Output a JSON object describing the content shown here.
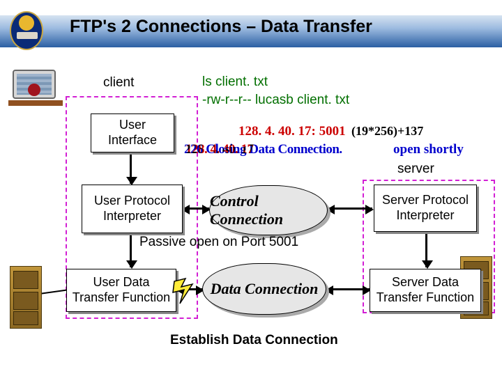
{
  "title": "FTP's 2 Connections – Data Transfer",
  "labels": {
    "client": "client",
    "server": "server",
    "user_interface": "User Interface",
    "user_pi": "User Protocol Interpreter",
    "user_dtf": "User Data Transfer Function",
    "server_pi": "Server Protocol Interpreter",
    "server_dtf": "Server Data Transfer Function",
    "control_conn": "Control Connection",
    "data_conn": "Data Connection",
    "passive_open": "Passive open on Port 5001",
    "establish": "Establish Data Connection"
  },
  "terminal": {
    "line1": "ls client. txt",
    "line2": "-rw-r--r-- lucasb client. txt"
  },
  "messages": {
    "ip_port": "128. 4. 40. 17: 5001",
    "calc": "(19*256)+137",
    "overlay1": "226 Closing Data Connection.",
    "overlay2": "128. 4. 40. 17",
    "overlay_tail": "open shortly"
  },
  "icons": {
    "workstation": "workstation-icon",
    "cabinet": "file-cabinet-icon",
    "bolt": "lightning-connection-icon",
    "logo": "university-crest-icon"
  }
}
